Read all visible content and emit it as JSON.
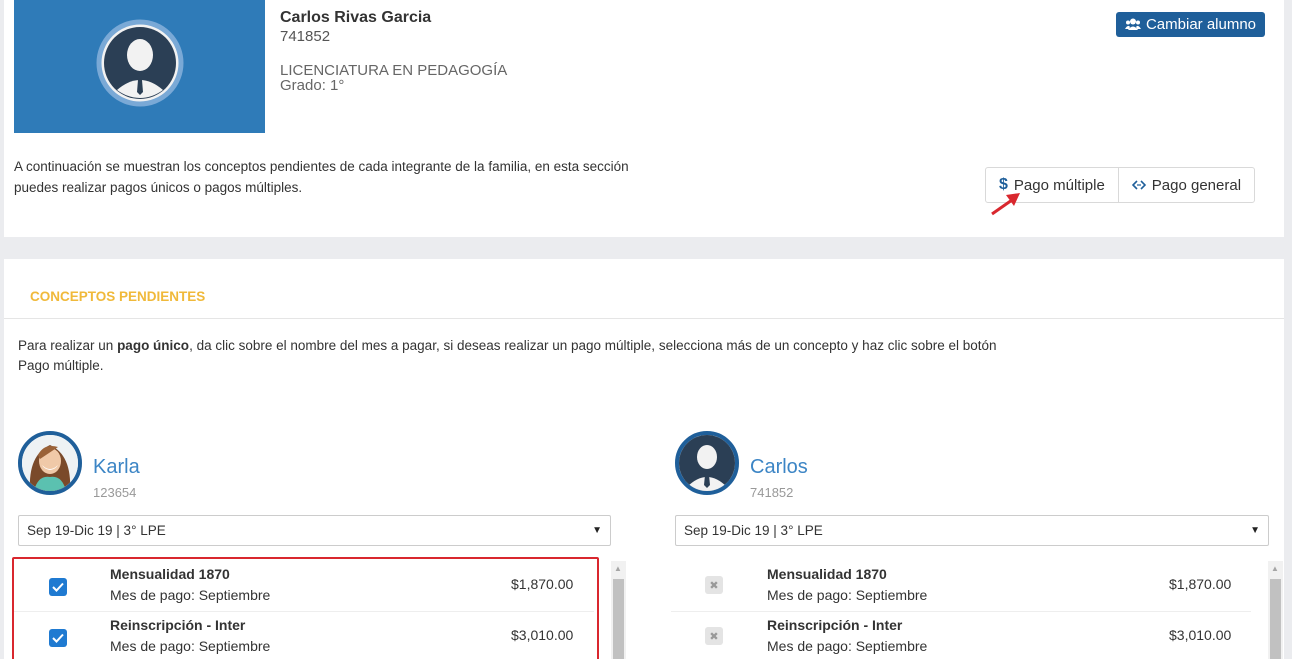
{
  "student": {
    "name": "Carlos Rivas Garcia",
    "id": "741852",
    "career": "LICENCIATURA EN PEDAGOGÍA",
    "grade": "Grado: 1°"
  },
  "header": {
    "change_student_label": "Cambiar alumno",
    "intro_text": "A continuación se muestran los conceptos pendientes de cada integrante de la familia, en esta sección puedes realizar pagos únicos o pagos múltiples.",
    "multi_payment_icon": "$",
    "multi_payment_label": "Pago múltiple",
    "general_payment_label": "Pago general"
  },
  "section": {
    "title": "CONCEPTOS PENDIENTES",
    "instructions_prefix": "Para realizar un ",
    "instructions_bold": "pago único",
    "instructions_suffix": ", da clic sobre el nombre del mes a pagar, si deseas realizar un pago múltiple, selecciona más de un concepto y haz clic sobre el botón Pago múltiple."
  },
  "members": [
    {
      "name": "Karla",
      "id": "123654",
      "period": "Sep 19-Dic 19 | 3° LPE",
      "concepts": [
        {
          "title": "Mensualidad 1870",
          "subtitle": "Mes de pago: Septiembre",
          "amount": "$1,870.00",
          "checked": true
        },
        {
          "title": "Reinscripción - Inter",
          "subtitle": "Mes de pago: Septiembre",
          "amount": "$3,010.00",
          "checked": true
        }
      ]
    },
    {
      "name": "Carlos",
      "id": "741852",
      "period": "Sep 19-Dic 19 | 3° LPE",
      "concepts": [
        {
          "title": "Mensualidad 1870",
          "subtitle": "Mes de pago: Septiembre",
          "amount": "$1,870.00",
          "checked": false
        },
        {
          "title": "Reinscripción - Inter",
          "subtitle": "Mes de pago: Septiembre",
          "amount": "$3,010.00",
          "checked": false
        }
      ]
    }
  ],
  "colors": {
    "primary": "#1f5f9a",
    "accent_title": "#f0b93a",
    "highlight_box": "#d9272e",
    "checkbox": "#1f7ad1"
  },
  "icons": {
    "change_student": "users-icon",
    "multi_payment": "dollar-icon",
    "general_payment": "code-icon",
    "annotation": "red-arrow-icon"
  }
}
